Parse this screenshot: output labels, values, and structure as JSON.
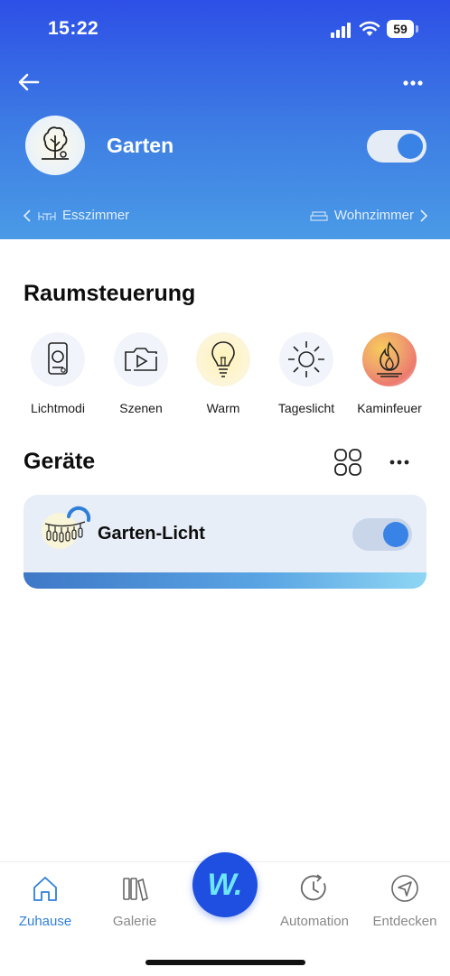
{
  "status": {
    "time": "15:22",
    "battery": "59"
  },
  "room": {
    "name": "Garten",
    "on": true,
    "prev": "Esszimmer",
    "next": "Wohnzimmer"
  },
  "control": {
    "title": "Raumsteuerung",
    "modes": [
      {
        "label": "Lichtmodi",
        "icon": "light-modes-icon"
      },
      {
        "label": "Szenen",
        "icon": "scenes-icon"
      },
      {
        "label": "Warm",
        "icon": "bulb-icon"
      },
      {
        "label": "Tageslicht",
        "icon": "sun-icon"
      },
      {
        "label": "Kaminfeuer",
        "icon": "fire-icon"
      }
    ]
  },
  "devices": {
    "title": "Geräte",
    "items": [
      {
        "name": "Garten-Licht",
        "on": true
      }
    ]
  },
  "tabs": [
    {
      "label": "Zuhause",
      "active": true
    },
    {
      "label": "Galerie",
      "active": false
    },
    {
      "label": "Automation",
      "active": false
    },
    {
      "label": "Entdecken",
      "active": false
    }
  ],
  "fab_letter": "W.",
  "colors": {
    "accent": "#3a83e6",
    "header_top": "#2d4fe6",
    "fab": "#1e4fe0",
    "active_tab": "#2f7fd8"
  }
}
